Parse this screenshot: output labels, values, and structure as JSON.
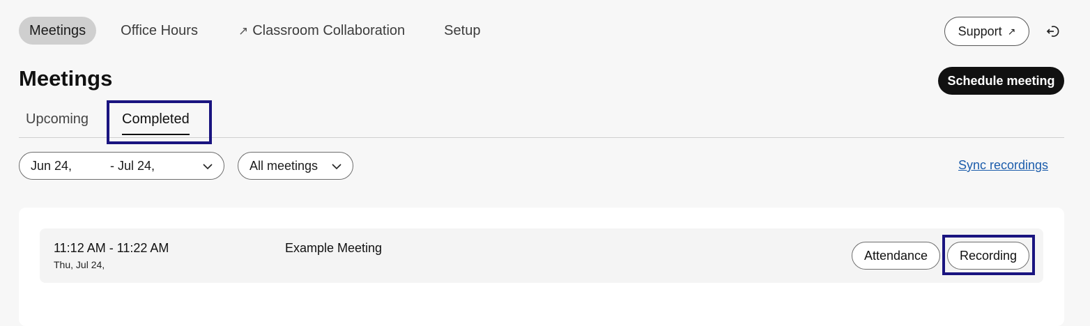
{
  "nav": {
    "items": [
      {
        "label": "Meetings",
        "active": true
      },
      {
        "label": "Office Hours",
        "active": false
      },
      {
        "label": "Classroom Collaboration",
        "active": false,
        "external_icon": "↗"
      },
      {
        "label": "Setup",
        "active": false
      }
    ],
    "support_label": "Support",
    "support_icon": "↗",
    "signout_icon": "sign-out-icon"
  },
  "page": {
    "title": "Meetings",
    "schedule_label": "Schedule meeting"
  },
  "tabs": [
    {
      "label": "Upcoming",
      "active": false
    },
    {
      "label": "Completed",
      "active": true
    }
  ],
  "filters": {
    "date_start": "Jun 24,",
    "date_end": "- Jul 24,",
    "meeting_filter": "All meetings",
    "sync_label": "Sync recordings"
  },
  "meetings": [
    {
      "time": "11:12 AM - 11:22 AM",
      "date": "Thu, Jul 24,",
      "title": "Example Meeting",
      "attendance_label": "Attendance",
      "recording_label": "Recording"
    }
  ],
  "colors": {
    "highlight_box": "#1a1480",
    "link": "#1b5cab",
    "primary_button": "#111111",
    "active_nav_bg": "#cfcfcf"
  }
}
